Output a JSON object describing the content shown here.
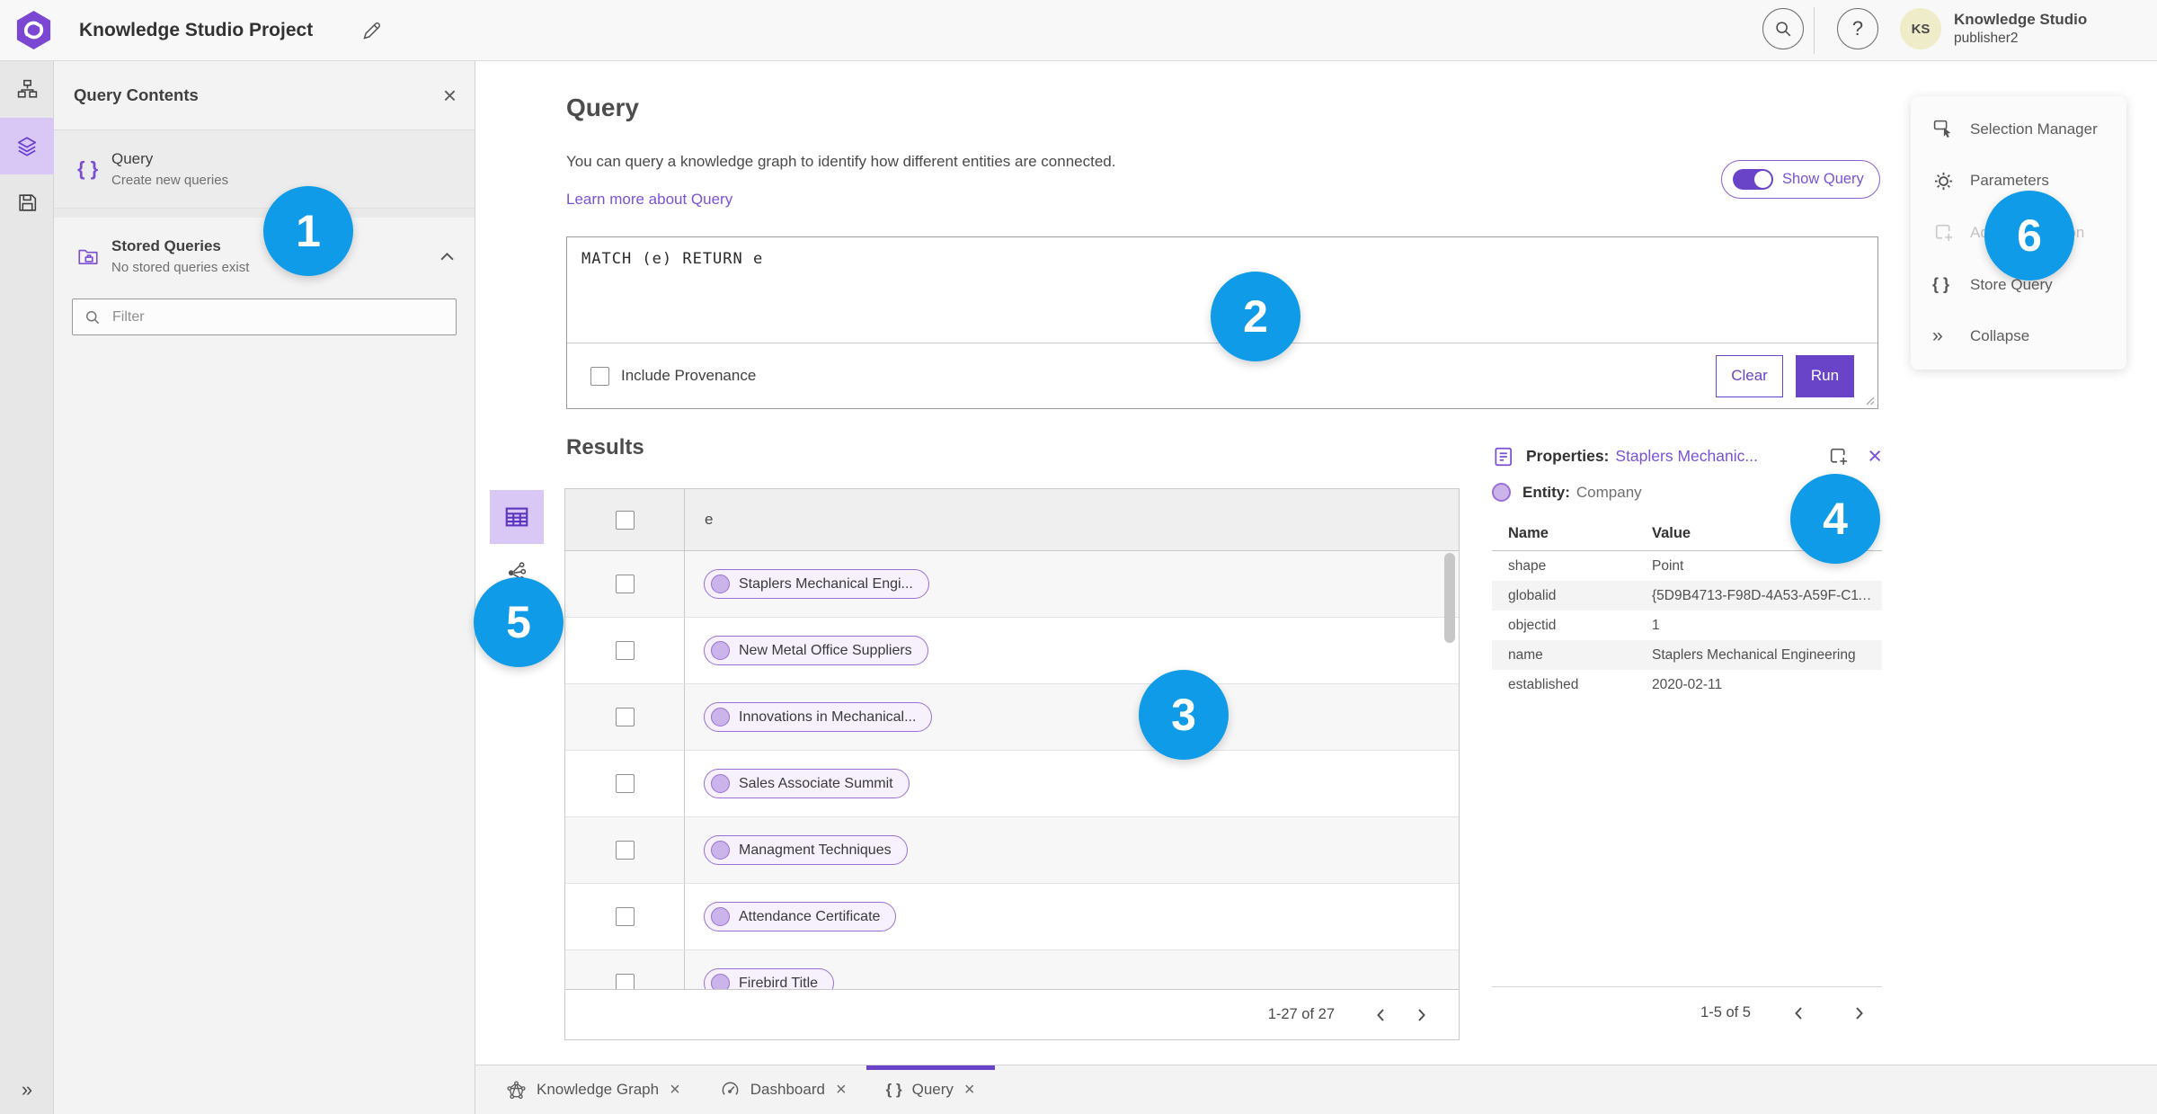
{
  "colors": {
    "accent_purple": "#6a44c8",
    "icon_purple": "#7b4fd4",
    "link_purple": "#7a52d6",
    "annotation_blue": "#0f9be8",
    "lavender_active_bg": "#d9c7f5",
    "chip_border": "#9a70d8",
    "chip_bg": "#f6f1fc",
    "avatar_bg": "#efecc9"
  },
  "topbar": {
    "title": "Knowledge Studio Project",
    "user": {
      "initials": "KS",
      "name": "Knowledge Studio",
      "username": "publisher2"
    }
  },
  "left_panel": {
    "title": "Query Contents",
    "query_item": {
      "title": "Query",
      "subtitle": "Create new queries"
    },
    "stored_queries": {
      "title": "Stored Queries",
      "subtitle": "No stored queries exist"
    },
    "filter": {
      "placeholder": "Filter"
    }
  },
  "query_panel": {
    "heading": "Query",
    "description": "You can query a knowledge graph to identify how different entities are connected.",
    "learn_more": "Learn more about Query",
    "show_query_label": "Show Query",
    "query_text": "MATCH (e) RETURN e",
    "include_provenance_label": "Include Provenance",
    "clear_label": "Clear",
    "run_label": "Run"
  },
  "results": {
    "heading": "Results",
    "column_header": "e",
    "rows": [
      "Staplers Mechanical Engi...",
      "New Metal Office Suppliers",
      "Innovations in Mechanical...",
      "Sales Associate Summit",
      "Managment Techniques",
      "Attendance Certificate",
      "Firebird Title"
    ],
    "pagination": "1-27 of 27"
  },
  "properties_panel": {
    "title": "Properties:",
    "entity_link": "Staplers Mechanic...",
    "entity_label": "Entity:",
    "entity_type": "Company",
    "name_header": "Name",
    "value_header": "Value",
    "rows": [
      {
        "name": "shape",
        "value": "Point"
      },
      {
        "name": "globalid",
        "value": "{5D9B4713-F98D-4A53-A59F-C11..."
      },
      {
        "name": "objectid",
        "value": "1"
      },
      {
        "name": "name",
        "value": "Staplers Mechanical Engineering"
      },
      {
        "name": "established",
        "value": "2020-02-11"
      }
    ],
    "pagination": "1-5 of 5"
  },
  "right_menu": {
    "items": [
      {
        "label": "Selection Manager"
      },
      {
        "label": "Parameters"
      },
      {
        "label": "Add To Selection"
      },
      {
        "label": "Store Query"
      },
      {
        "label": "Collapse"
      }
    ]
  },
  "tabs": [
    {
      "label": "Knowledge Graph"
    },
    {
      "label": "Dashboard"
    },
    {
      "label": "Query"
    }
  ],
  "annotations": [
    "1",
    "2",
    "3",
    "4",
    "5",
    "6"
  ],
  "glyphs": {
    "braces": "{ }",
    "collapse_chevrons": "»",
    "question": "?",
    "close": "×"
  }
}
